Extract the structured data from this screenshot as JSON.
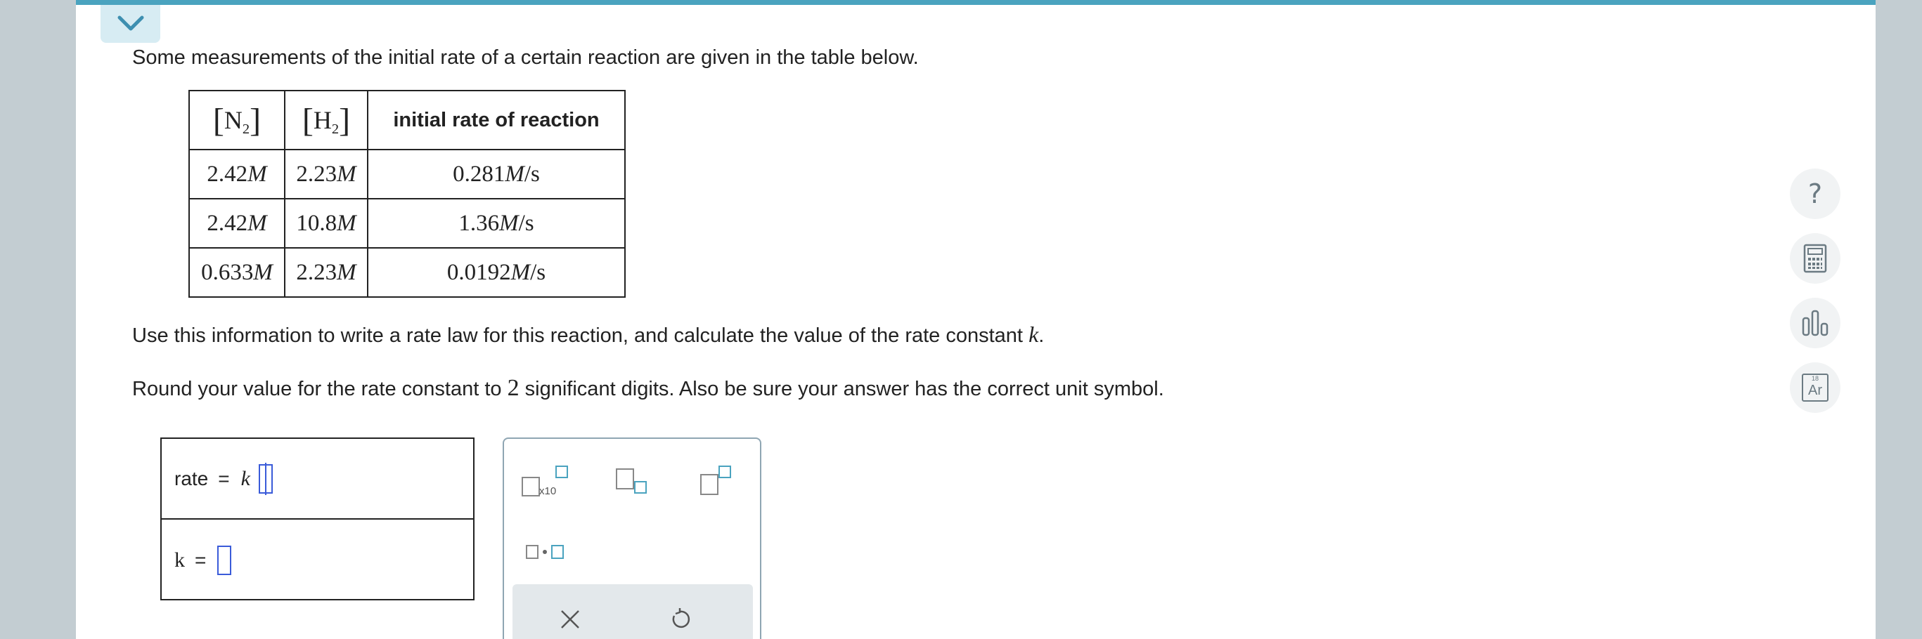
{
  "prompt": {
    "intro": "Some measurements of the initial rate of a certain reaction are given in the table below.",
    "instruction_prefix": "Use this information to write a rate law for this reaction, and calculate the value of the rate constant ",
    "instruction_var": "k",
    "instruction_suffix": ".",
    "round_prefix": "Round your value for the rate constant to ",
    "round_digits": "2",
    "round_suffix": " significant digits. Also be sure your answer has the correct unit symbol."
  },
  "table": {
    "headers": [
      {
        "species": "N",
        "sub": "2"
      },
      {
        "species": "H",
        "sub": "2"
      }
    ],
    "rate_header": "initial rate of reaction",
    "rows": [
      {
        "n2": "2.42",
        "h2": "2.23",
        "rate": "0.281"
      },
      {
        "n2": "2.42",
        "h2": "10.8",
        "rate": "1.36"
      },
      {
        "n2": "0.633",
        "h2": "2.23",
        "rate": "0.0192"
      }
    ],
    "conc_unit": "M",
    "rate_unit_num": "M",
    "rate_unit_den": "/s"
  },
  "answer": {
    "rate_label": "rate",
    "equals": "=",
    "rate_k": "k",
    "k_label": "k",
    "k_equals": "="
  },
  "palette": {
    "x10_label": "x10"
  },
  "toolbar": {
    "help_symbol": "?",
    "periodic_symbol": "Ar",
    "periodic_number": "18"
  },
  "colors": {
    "accent": "#4aa3bf",
    "input": "#3a5bd9",
    "palette_blue": "#4aa3bf"
  }
}
